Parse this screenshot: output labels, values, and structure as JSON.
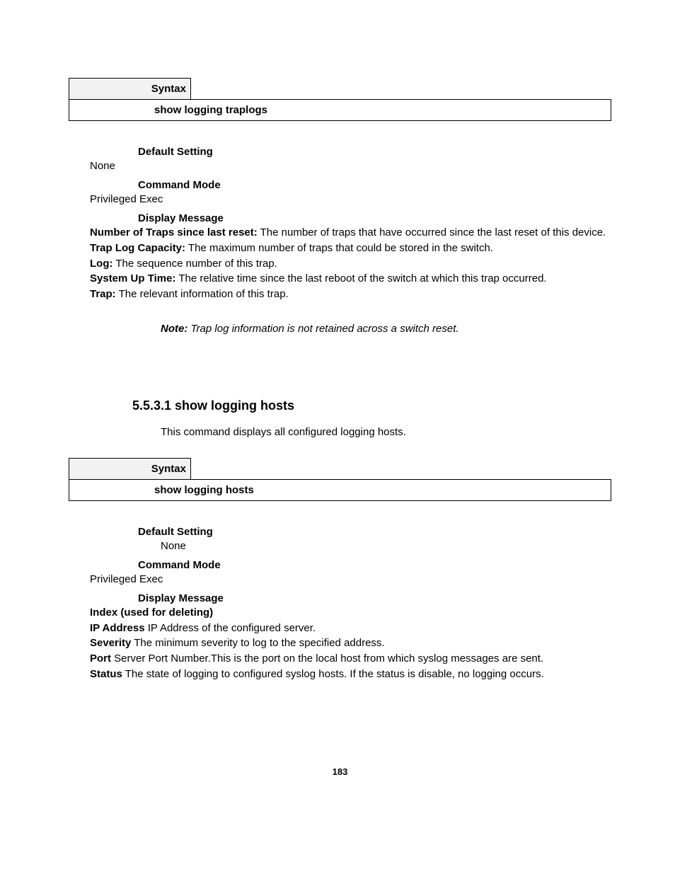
{
  "block1": {
    "syntax_label": "Syntax",
    "command": "show logging traplogs",
    "default_setting_head": "Default Setting",
    "default_setting_val": "None",
    "command_mode_head": "Command Mode",
    "command_mode_val": "Privileged Exec",
    "display_message_head": "Display Message",
    "items": {
      "traps_b": "Number of Traps since last reset:",
      "traps_t": " The number of traps that have occurred since the last reset of this device.",
      "cap_b": "Trap Log Capacity:",
      "cap_t": " The maximum number of traps that could be stored in the switch.",
      "log_b": "Log:",
      "log_t": " The sequence number of this trap.",
      "sys_b": "System Up Time:",
      "sys_t": " The relative time since the last reboot of the switch at which this trap occurred.",
      "trap_b": "Trap:",
      "trap_t": " The relevant information of this trap."
    },
    "note_lead": "Note:",
    "note_text": " Trap log information is not retained across a switch reset."
  },
  "section": {
    "number": "5.5.3.1 ",
    "title": "show logging hosts",
    "intro": "This command displays all configured logging hosts."
  },
  "block2": {
    "syntax_label": "Syntax",
    "command": "show logging hosts",
    "default_setting_head": "Default Setting",
    "default_setting_val": "None",
    "command_mode_head": "Command Mode",
    "command_mode_val": "Privileged Exec",
    "display_message_head": "Display Message",
    "items": {
      "index_b": "Index (used for deleting)",
      "ip_b": "IP Address",
      "ip_t": " IP Address of the configured server.",
      "sev_b": "Severity",
      "sev_t": " The minimum severity to log to the specified address.",
      "port_b": "Port",
      "port_t": " Server Port Number.This is the port on the local host from which syslog messages are sent.",
      "stat_b": "Status",
      "stat_t": " The state of logging to configured syslog hosts. If the status is disable, no logging occurs."
    }
  },
  "page_number": "183"
}
